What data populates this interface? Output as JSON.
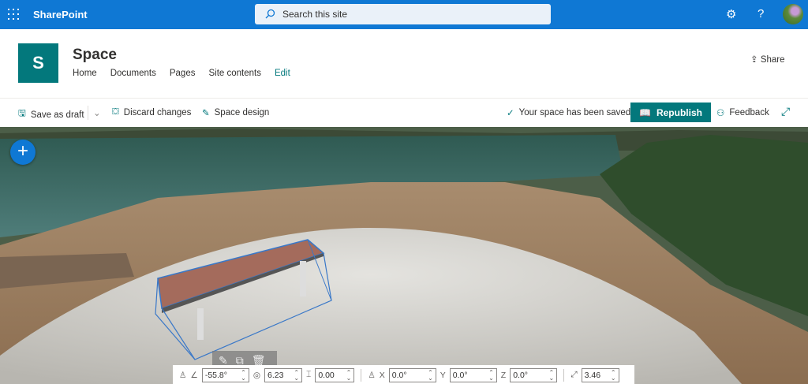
{
  "topbar": {
    "brand": "SharePoint",
    "search_placeholder": "Search this site",
    "settings_icon": "⚙",
    "help_icon": "?"
  },
  "site": {
    "logo_letter": "S",
    "title": "Space",
    "nav": [
      "Home",
      "Documents",
      "Pages",
      "Site contents",
      "Edit"
    ],
    "share": "Share"
  },
  "command": {
    "save_draft": "Save as draft",
    "discard": "Discard changes",
    "space_design": "Space design",
    "saved_status": "Your space has been saved",
    "republish": "Republish",
    "feedback": "Feedback"
  },
  "scene": {
    "add": "+"
  },
  "properties": {
    "tilt": "-55.8°",
    "radius": "6.23",
    "height": "0.00",
    "x_label": "X",
    "x": "0.0°",
    "y_label": "Y",
    "y": "0.0°",
    "z_label": "Z",
    "z": "0.0°",
    "scale": "3.46"
  },
  "colors": {
    "brand": "#0f78d4",
    "accent": "#03787c"
  }
}
